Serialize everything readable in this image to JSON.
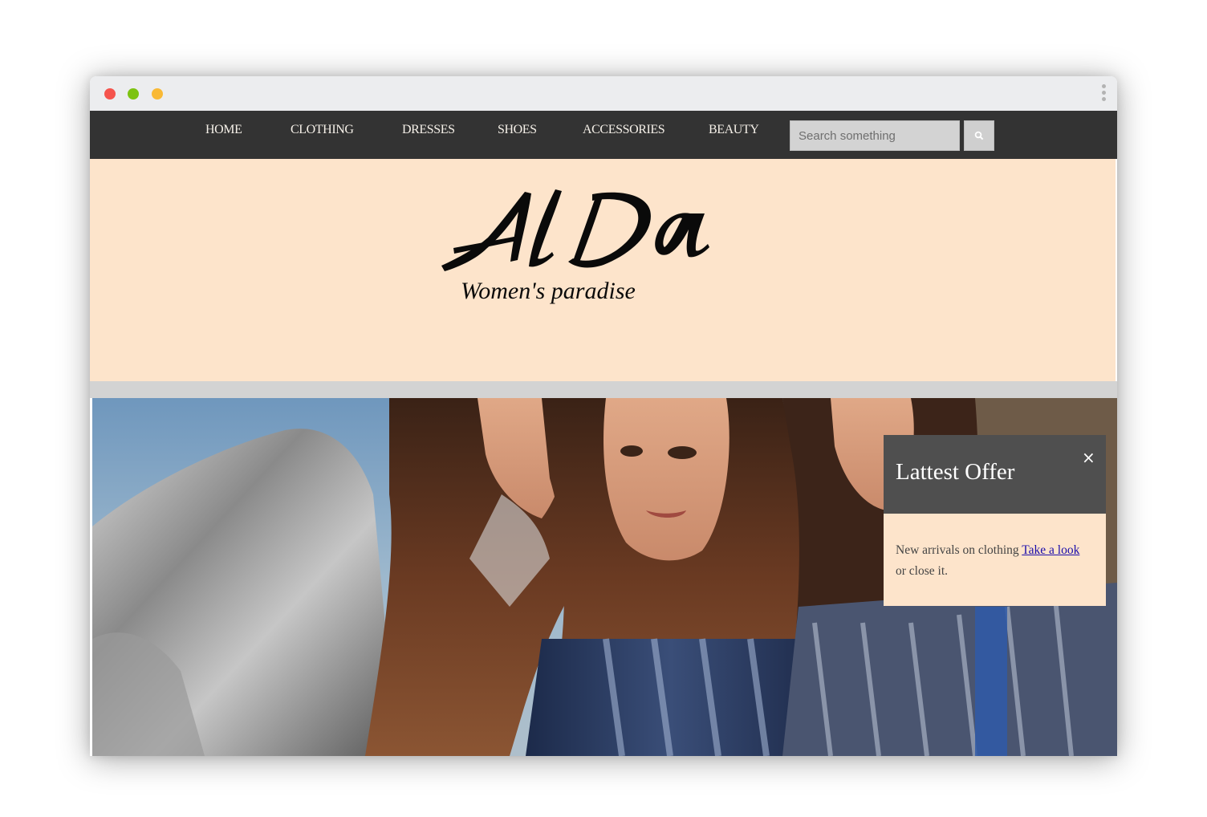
{
  "nav": {
    "items": [
      {
        "label": "HOME"
      },
      {
        "label": "CLOTHING"
      },
      {
        "label": "DRESSES"
      },
      {
        "label": "SHOES"
      },
      {
        "label": "ACCESSORIES"
      },
      {
        "label": "BEAUTY"
      }
    ],
    "search_placeholder": "Search something",
    "search_icon": "search-icon"
  },
  "brand": {
    "logo_text": "AlDa",
    "tagline": "Women's paradise"
  },
  "offer": {
    "title": "Lattest Offer",
    "close_icon": "close-icon",
    "body_text": "New arrivals on clothing ",
    "link_text": "Take a look",
    "tail_text": "or close it."
  },
  "colors": {
    "navbar": "#333333",
    "header_bg": "#fde4cb",
    "popup_head": "#4f4f4f",
    "link": "#1a0dab"
  }
}
